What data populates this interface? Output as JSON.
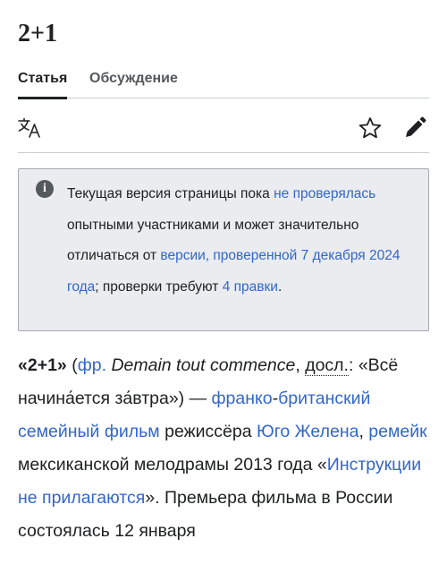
{
  "page": {
    "title": "2+1"
  },
  "tabs": [
    {
      "label": "Статья",
      "active": true
    },
    {
      "label": "Обсуждение",
      "active": false
    }
  ],
  "toolbar": {
    "language_icon": "translate-icon",
    "watch_icon": "star-icon",
    "edit_icon": "pencil-icon"
  },
  "notice": {
    "icon_glyph": "i",
    "t1": "Текущая версия страницы пока ",
    "link1": "не проверялась",
    "t2": " опытными участниками и может значительно отличаться от ",
    "link2": "версии, проверенной 7 декабря 2024 года",
    "t3": "; проверки требуют ",
    "link3": "4 правки",
    "t4": "."
  },
  "article": {
    "title_bold": "«2+1»",
    "p1": " (",
    "lang_link": "фр.",
    "p2": " ",
    "original_title": "Demain tout commence",
    "p3": ", ",
    "literal_abbr": "досл.",
    "p4": ": «Всё начина́ется за́втра») — ",
    "link_country1": "франко",
    "p5": "-",
    "link_country2": "британский",
    "p6": " ",
    "link_genre": "семейный фильм",
    "p7": " режиссёра ",
    "link_director": "Юго Желена",
    "p8": ", ",
    "link_remake": "ремейк",
    "p9": " мексиканской мелодрамы 2013 года «",
    "link_original": "Инструкции не прилагаются",
    "p10": "». Премьера фильма в России состоялась 12 января"
  },
  "colors": {
    "link": "#3366cc",
    "text": "#202122",
    "notice_bg": "#eaecf0",
    "notice_border": "#a2a9b1",
    "divider": "#c8ccd1"
  }
}
